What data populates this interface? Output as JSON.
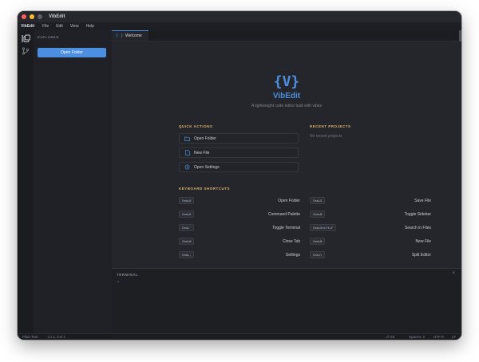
{
  "window": {
    "title": "VibEdit"
  },
  "menu": {
    "app": "VibEdit",
    "items": [
      "File",
      "Edit",
      "View",
      "Help"
    ]
  },
  "activity": {
    "icons": [
      "files-icon",
      "git-branch-icon"
    ]
  },
  "sidebar": {
    "title": "EXPLORER",
    "open_folder": "Open Folder"
  },
  "tabs": [
    {
      "icon": "{ }",
      "label": "Welcome"
    }
  ],
  "welcome": {
    "logo": "{V}",
    "name": "VibEdit",
    "tagline": "A lightweight code editor built with vibes",
    "quick_actions_title": "QUICK ACTIONS",
    "quick_actions": [
      {
        "label": "Open Folder",
        "icon": "folder-icon"
      },
      {
        "label": "New File",
        "icon": "file-icon"
      },
      {
        "label": "Open Settings",
        "icon": "gear-icon"
      }
    ],
    "recent_title": "RECENT PROJECTS",
    "recent_empty": "No recent projects",
    "shortcuts_title": "KEYBOARD SHORTCUTS",
    "shortcuts_left": [
      {
        "key": "Cmd+O",
        "label": "Open Folder"
      },
      {
        "key": "Cmd+K",
        "label": "Command Palette"
      },
      {
        "key": "Cmd+`",
        "label": "Toggle Terminal"
      },
      {
        "key": "Cmd+W",
        "label": "Close Tab"
      },
      {
        "key": "Cmd+,",
        "label": "Settings"
      }
    ],
    "shortcuts_right": [
      {
        "key": "Cmd+S",
        "label": "Save File"
      },
      {
        "key": "Cmd+B",
        "label": "Toggle Sidebar"
      },
      {
        "key": "Cmd+Shift+F",
        "label": "Search in Files"
      },
      {
        "key": "Cmd+N",
        "label": "New File"
      },
      {
        "key": "Cmd+\\",
        "label": "Split Editor"
      }
    ]
  },
  "terminal": {
    "title": "TERMINAL",
    "close": "×",
    "prompt": "→"
  },
  "status": {
    "language": "Plain Text",
    "position": "Ln 1, Col 1",
    "branch": "⎇ Git",
    "spaces": "Spaces: 2",
    "encoding": "UTF-8",
    "eol": "LF"
  },
  "colors": {
    "accent": "#4c8fe0",
    "section": "#e0b36a",
    "background": "#24262b"
  }
}
